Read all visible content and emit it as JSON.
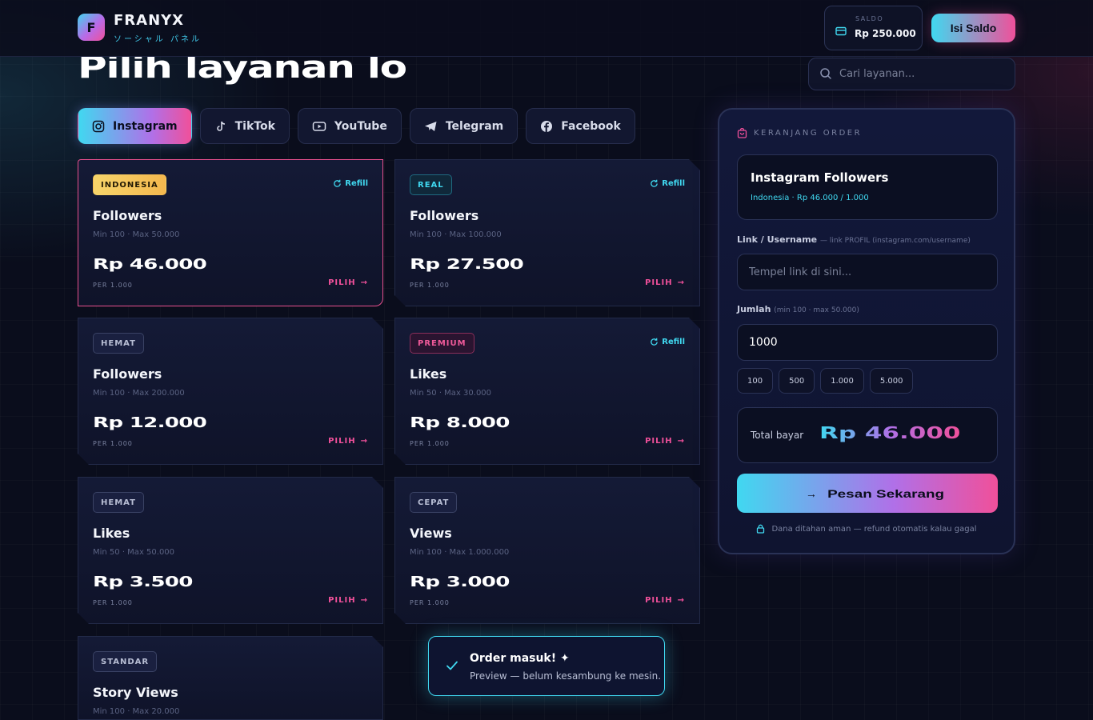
{
  "brand": {
    "logo_letter": "F",
    "name": "FRANYX",
    "subtitle": "ソーシャル パネル"
  },
  "saldo": {
    "label": "SALDO",
    "value": "Rp 250.000"
  },
  "topup_button": "Isi Saldo",
  "page_title": "Pilih layanan lo",
  "search": {
    "placeholder": "Cari layanan..."
  },
  "tabs": [
    {
      "label": "Instagram",
      "icon": "instagram-icon",
      "active": true
    },
    {
      "label": "TikTok",
      "icon": "tiktok-icon"
    },
    {
      "label": "YouTube",
      "icon": "youtube-icon"
    },
    {
      "label": "Telegram",
      "icon": "telegram-icon"
    },
    {
      "label": "Facebook",
      "icon": "facebook-icon"
    }
  ],
  "services": [
    {
      "badge": "INDONESIA",
      "refill": "Refill",
      "name": "Followers",
      "limits": "Min 100 · Max 50.000",
      "price": "Rp 46.000",
      "per": "PER 1.000",
      "action": "PILIH"
    },
    {
      "badge": "REAL",
      "refill": "Refill",
      "name": "Followers",
      "limits": "Min 100 · Max 100.000",
      "price": "Rp 27.500",
      "per": "PER 1.000",
      "action": "PILIH"
    },
    {
      "badge": "HEMAT",
      "name": "Followers",
      "limits": "Min 100 · Max 200.000",
      "price": "Rp 12.000",
      "per": "PER 1.000",
      "action": "PILIH"
    },
    {
      "badge": "PREMIUM",
      "refill": "Refill",
      "name": "Likes",
      "limits": "Min 50 · Max 30.000",
      "price": "Rp 8.000",
      "per": "PER 1.000",
      "action": "PILIH"
    },
    {
      "badge": "HEMAT",
      "name": "Likes",
      "limits": "Min 50 · Max 50.000",
      "price": "Rp 3.500",
      "per": "PER 1.000",
      "action": "PILIH"
    },
    {
      "badge": "CEPAT",
      "name": "Views",
      "limits": "Min 100 · Max 1.000.000",
      "price": "Rp 3.000",
      "per": "PER 1.000",
      "action": "PILIH"
    },
    {
      "badge": "STANDAR",
      "name": "Story Views",
      "limits": "Min 100 · Max 20.000"
    }
  ],
  "cart": {
    "title": "KERANJANG ORDER",
    "item_name": "Instagram Followers",
    "item_meta": "Indonesia · Rp 46.000 / 1.000",
    "link_label": "Link / Username",
    "link_hint": "— link PROFIL (instagram.com/username)",
    "link_placeholder": "Tempel link di sini...",
    "qty_label": "Jumlah",
    "qty_hint": "(min 100 · max 50.000)",
    "qty_value": "1000",
    "chips": [
      "100",
      "500",
      "1.000",
      "5.000"
    ],
    "total_label": "Total bayar",
    "total_value": "Rp 46.000",
    "order_button": "Pesan Sekarang",
    "secure_note": "Dana ditahan aman — refund otomatis kalau gagal"
  },
  "toast": {
    "title": "Order masuk! ✦",
    "subtitle": "Preview — belum kesambung ke mesin."
  },
  "colors": {
    "accent_cyan": "#40d8f0",
    "accent_pink": "#f0509a",
    "accent_purple": "#b070e8",
    "badge_yellow": "#f7d46a",
    "background": "#0a0d1c"
  }
}
